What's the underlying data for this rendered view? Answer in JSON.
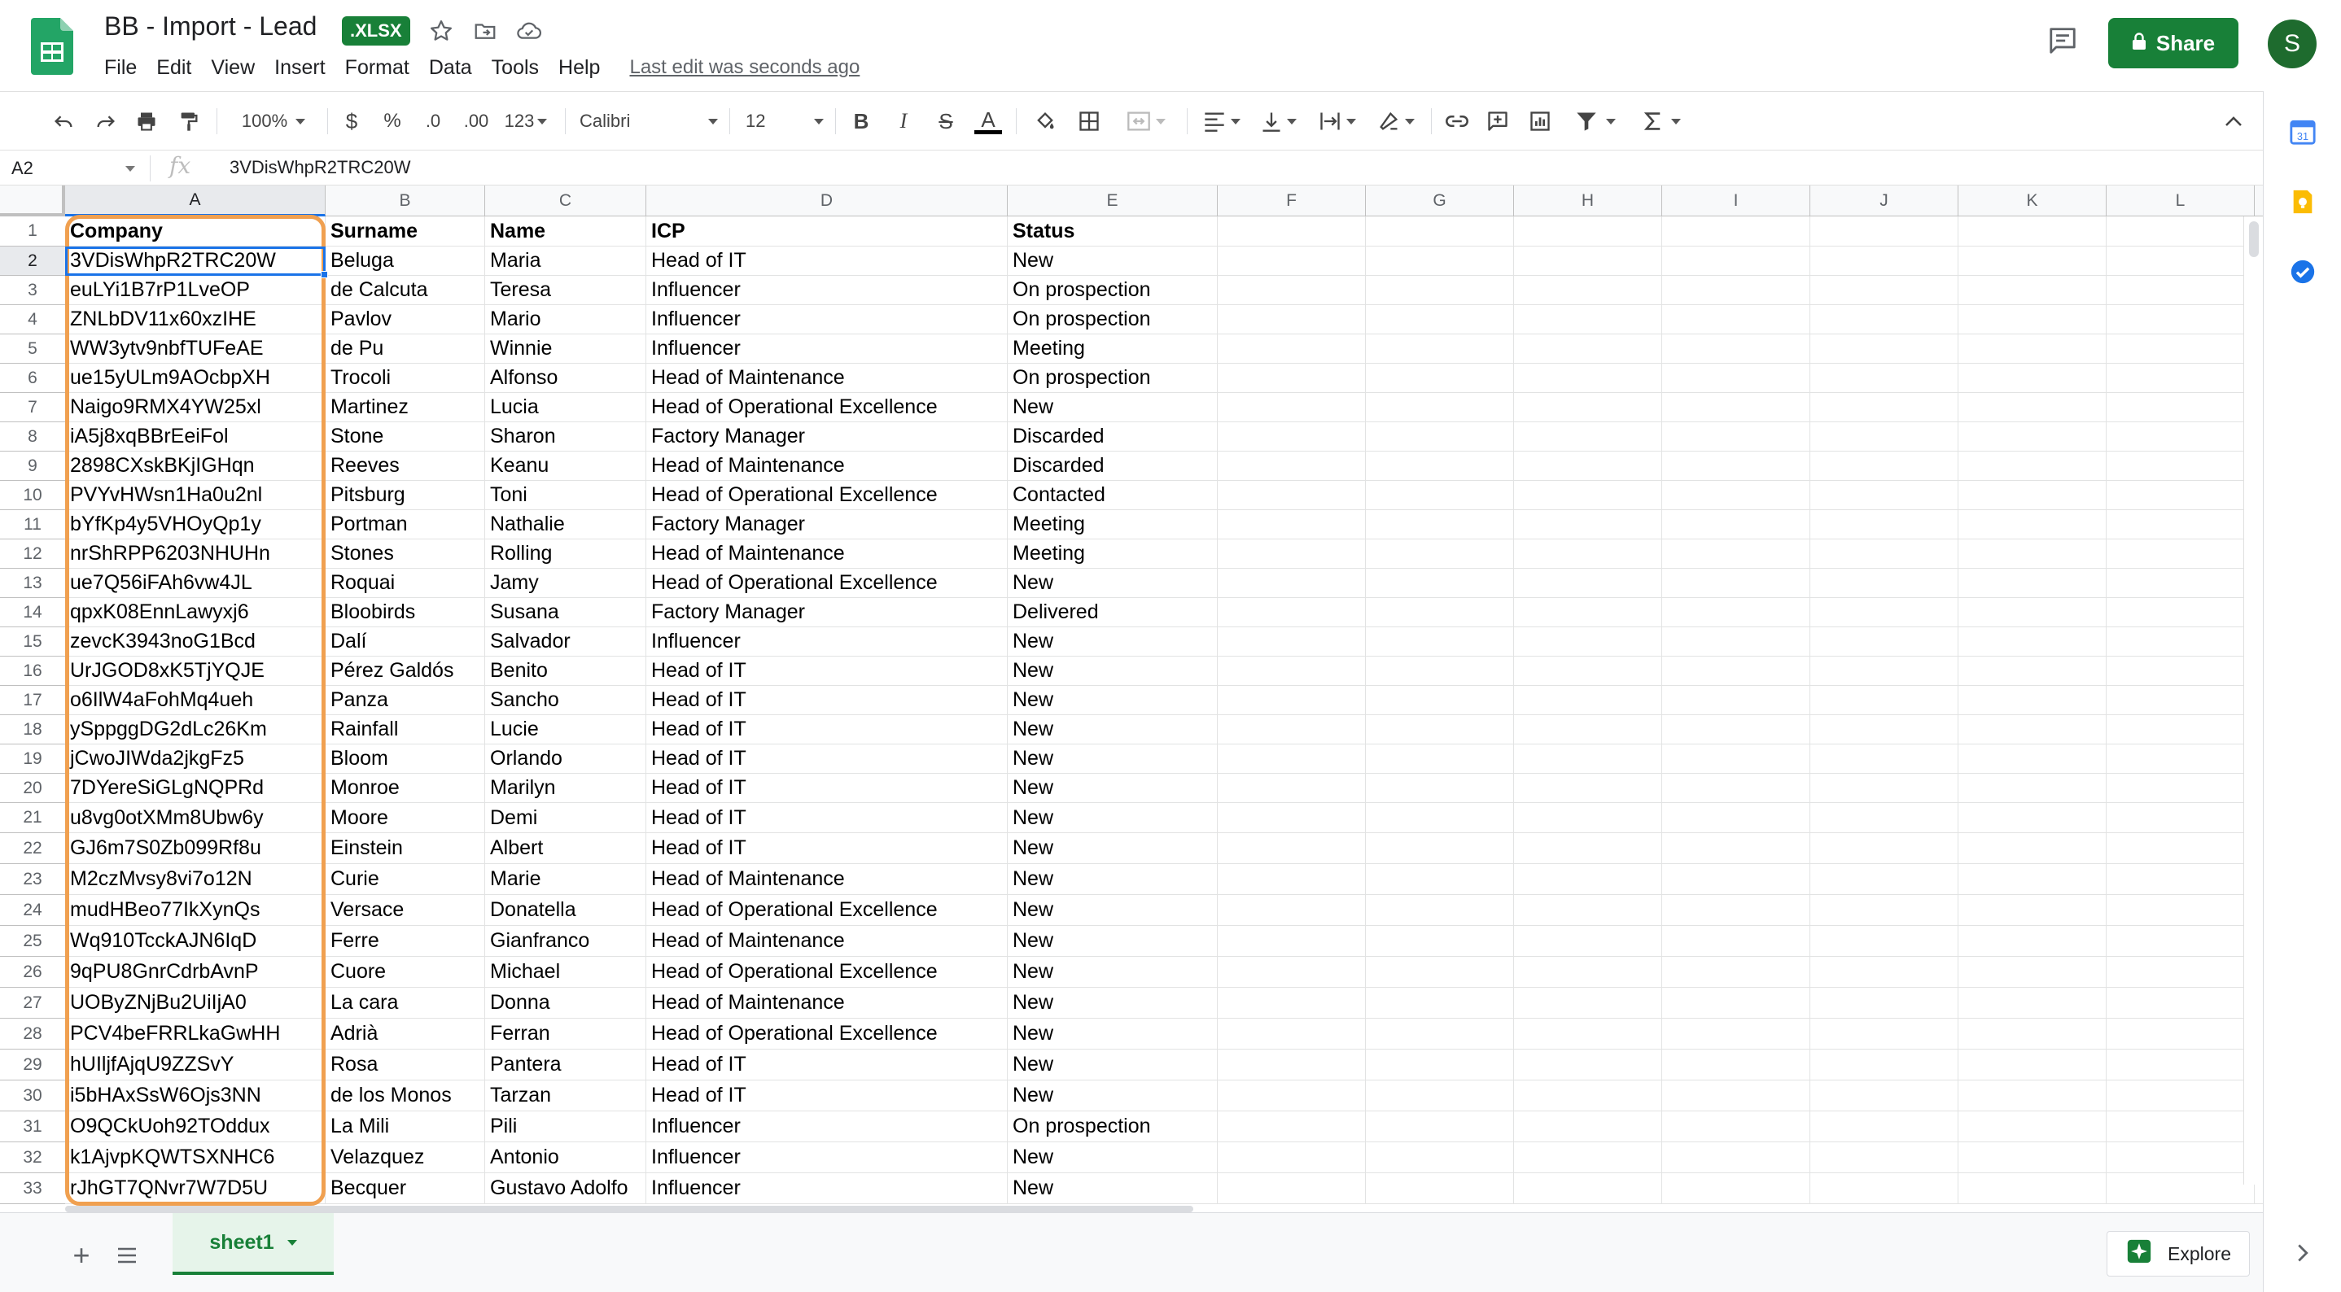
{
  "header": {
    "title": "BB - Import - Lead",
    "file_badge": ".XLSX",
    "menu": [
      "File",
      "Edit",
      "View",
      "Insert",
      "Format",
      "Data",
      "Tools",
      "Help"
    ],
    "last_edit": "Last edit was seconds ago",
    "share_label": "Share",
    "avatar_initial": "S"
  },
  "toolbar": {
    "zoom": "100%",
    "currency": "$",
    "percent": "%",
    "decrease_decimal": ".0",
    "increase_decimal": ".00",
    "more_formats": "123",
    "font": "Calibri",
    "font_size": "12",
    "bold": "B",
    "italic": "I",
    "strike": "S",
    "text_color": "A"
  },
  "formula_bar": {
    "name_box": "A2",
    "fx": "fx",
    "value": "3VDisWhpR2TRC20W"
  },
  "grid": {
    "columns": [
      "A",
      "B",
      "C",
      "D",
      "E",
      "F",
      "G",
      "H",
      "I",
      "J",
      "K",
      "L"
    ],
    "rows": [
      [
        "Company",
        "Surname",
        "Name",
        "ICP",
        "Status"
      ],
      [
        "3VDisWhpR2TRC20W",
        "Beluga",
        "Maria",
        "Head of IT",
        "New"
      ],
      [
        "euLYi1B7rP1LveOP",
        "de Calcuta",
        "Teresa",
        "Influencer",
        "On prospection"
      ],
      [
        "ZNLbDV11x60xzIHE",
        "Pavlov",
        "Mario",
        "Influencer",
        "On prospection"
      ],
      [
        "WW3ytv9nbfTUFeAE",
        "de Pu",
        "Winnie",
        "Influencer",
        "Meeting"
      ],
      [
        "ue15yULm9AOcbpXH",
        "Trocoli",
        "Alfonso",
        "Head of Maintenance",
        "On prospection"
      ],
      [
        "Naigo9RMX4YW25xl",
        "Martinez",
        "Lucia",
        "Head of Operational Excellence",
        "New"
      ],
      [
        "iA5j8xqBBrEeiFol",
        "Stone",
        "Sharon",
        "Factory Manager",
        "Discarded"
      ],
      [
        "2898CXskBKjIGHqn",
        "Reeves",
        "Keanu",
        "Head of Maintenance",
        "Discarded"
      ],
      [
        "PVYvHWsn1Ha0u2nl",
        "Pitsburg",
        "Toni",
        "Head of Operational Excellence",
        "Contacted"
      ],
      [
        "bYfKp4y5VHOyQp1y",
        "Portman",
        "Nathalie",
        "Factory Manager",
        "Meeting"
      ],
      [
        "nrShRPP6203NHUHn",
        "Stones",
        "Rolling",
        "Head of Maintenance",
        "Meeting"
      ],
      [
        "ue7Q56iFAh6vw4JL",
        "Roquai",
        "Jamy",
        "Head of Operational Excellence",
        "New"
      ],
      [
        "qpxK08EnnLawyxj6",
        "Bloobirds",
        "Susana",
        "Factory Manager",
        "Delivered"
      ],
      [
        "zevcK3943noG1Bcd",
        "Dalí",
        "Salvador",
        "Influencer",
        "New"
      ],
      [
        "UrJGOD8xK5TjYQJE",
        "Pérez Galdós",
        "Benito",
        "Head of IT",
        "New"
      ],
      [
        "o6IlW4aFohMq4ueh",
        "Panza",
        "Sancho",
        "Head of IT",
        "New"
      ],
      [
        "ySppggDG2dLc26Km",
        "Rainfall",
        "Lucie",
        "Head of IT",
        "New"
      ],
      [
        "jCwoJIWda2jkgFz5",
        "Bloom",
        "Orlando",
        "Head of IT",
        "New"
      ],
      [
        "7DYereSiGLgNQPRd",
        "Monroe",
        "Marilyn",
        "Head of IT",
        "New"
      ],
      [
        "u8vg0otXMm8Ubw6y",
        "Moore",
        "Demi",
        "Head of IT",
        "New"
      ],
      [
        "GJ6m7S0Zb099Rf8u",
        "Einstein",
        "Albert",
        "Head of IT",
        "New"
      ],
      [
        "M2czMvsy8vi7o12N",
        "Curie",
        "Marie",
        "Head of Maintenance",
        "New"
      ],
      [
        "mudHBeo77IkXynQs",
        "Versace",
        "Donatella",
        "Head of Operational Excellence",
        "New"
      ],
      [
        "Wq910TcckAJN6IqD",
        "Ferre",
        "Gianfranco",
        "Head of Maintenance",
        "New"
      ],
      [
        "9qPU8GnrCdrbAvnP",
        "Cuore",
        "Michael",
        "Head of Operational Excellence",
        "New"
      ],
      [
        "UOByZNjBu2UiIjA0",
        "La cara",
        "Donna",
        "Head of Maintenance",
        "New"
      ],
      [
        "PCV4beFRRLkaGwHH",
        "Adrià",
        "Ferran",
        "Head of Operational Excellence",
        "New"
      ],
      [
        "hUIljfAjqU9ZZSvY",
        "Rosa",
        "Pantera",
        "Head of IT",
        "New"
      ],
      [
        "i5bHAxSsW6Ojs3NN",
        "de los Monos",
        "Tarzan",
        "Head of IT",
        "New"
      ],
      [
        "O9QCkUoh92TOddux",
        "La Mili",
        "Pili",
        "Influencer",
        "On prospection"
      ],
      [
        "k1AjvpKQWTSXNHC6",
        "Velazquez",
        "Antonio",
        "Influencer",
        "New"
      ],
      [
        "rJhGT7QNvr7W7D5U",
        "Becquer",
        "Gustavo Adolfo",
        "Influencer",
        "New"
      ]
    ]
  },
  "sheets": {
    "active": "sheet1",
    "explore_label": "Explore"
  },
  "colors": {
    "brand_green": "#188038",
    "selection_blue": "#1a73e8",
    "highlight_orange": "#f0a050"
  },
  "icons": {
    "logo": "sheets-logo-icon",
    "star": "star-icon",
    "move": "folder-move-icon",
    "cloud": "cloud-status-icon",
    "comments": "comment-history-icon",
    "lock": "lock-icon"
  }
}
